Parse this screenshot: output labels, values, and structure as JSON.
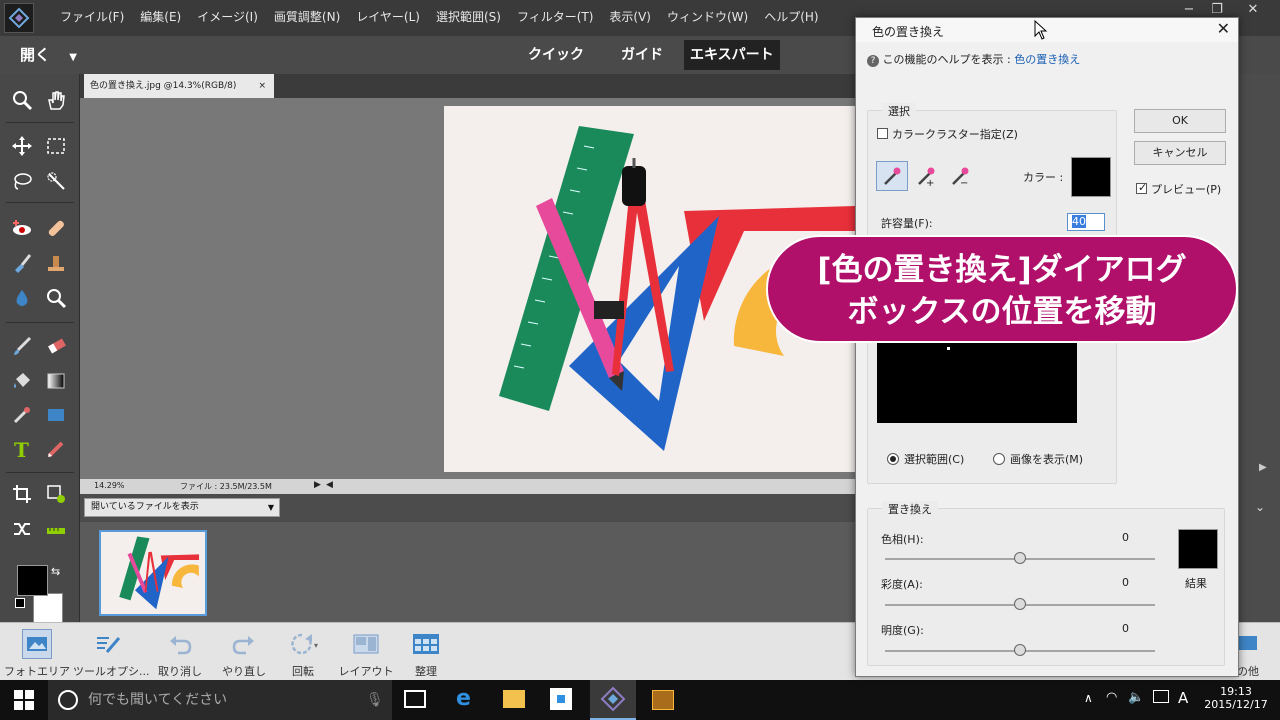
{
  "menubar": {
    "items": [
      "ファイル(F)",
      "編集(E)",
      "イメージ(I)",
      "画質調整(N)",
      "レイヤー(L)",
      "選択範囲(S)",
      "フィルター(T)",
      "表示(V)",
      "ウィンドウ(W)",
      "ヘルプ(H)"
    ],
    "controls": [
      "−",
      "❐",
      "✕"
    ]
  },
  "modebar": {
    "open_label": "開く",
    "tabs": [
      "クイック",
      "ガイド",
      "エキスパート"
    ],
    "active_tab": "エキスパート"
  },
  "document": {
    "tab_title": "色の置き換え.jpg @14.3%(RGB/8)",
    "tab_close": "×",
    "zoom": "14.29%",
    "file_info": "ファイル : 23.5M/23.5M"
  },
  "bin": {
    "select_value": "開いているファイルを表示"
  },
  "app_buttons": [
    {
      "label": "フォトエリア",
      "icon": "photo-bin-icon"
    },
    {
      "label": "ツールオプシ...",
      "icon": "tool-options-icon"
    },
    {
      "label": "取り消し",
      "icon": "undo-icon"
    },
    {
      "label": "やり直し",
      "icon": "redo-icon"
    },
    {
      "label": "回転",
      "icon": "rotate-icon"
    },
    {
      "label": "レイアウト",
      "icon": "layout-icon"
    },
    {
      "label": "整理",
      "icon": "organizer-icon"
    },
    {
      "label": "の他",
      "icon": "more-icon"
    }
  ],
  "dialog": {
    "title": "色の置き換え",
    "help_prefix": "この機能のヘルプを表示 :",
    "help_link": "色の置き換え",
    "ok": "OK",
    "cancel": "キャンセル",
    "preview": "プレビュー(P)",
    "selection_group": "選択",
    "color_cluster": "カラークラスター指定(Z)",
    "color_label": "カラー :",
    "tolerance_label": "許容量(F):",
    "tolerance_value": "40",
    "radio_selection": "選択範囲(C)",
    "radio_image": "画像を表示(M)",
    "replace_group": "置き換え",
    "hue_label": "色相(H):",
    "hue_value": "0",
    "saturation_label": "彩度(A):",
    "saturation_value": "0",
    "lightness_label": "明度(G):",
    "lightness_value": "0",
    "result_label": "結果",
    "swatch_color": "#000000",
    "result_color": "#000000"
  },
  "callout": {
    "line1": "[色の置き換え]ダイアログ",
    "line2": "ボックスの位置を移動",
    "color": "#b0106a"
  },
  "taskbar": {
    "search_placeholder": "何でも聞いてください",
    "time": "19:13",
    "date": "2015/12/17",
    "ime": "A"
  }
}
